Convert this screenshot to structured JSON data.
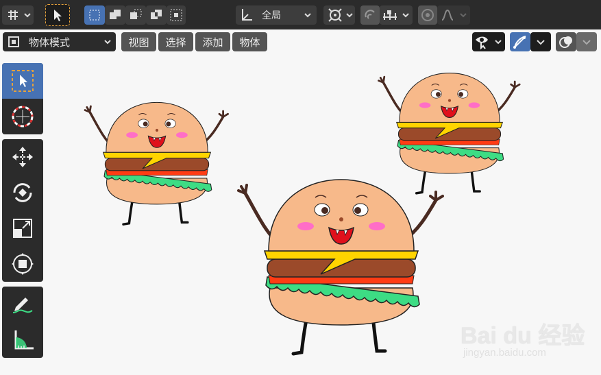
{
  "header": {
    "transform_orientation": "全局",
    "mode_selector": "物体模式"
  },
  "menus": [
    {
      "label": "视图"
    },
    {
      "label": "选择"
    },
    {
      "label": "添加"
    },
    {
      "label": "物体"
    }
  ],
  "toolbar_tools": [
    {
      "name": "select-box-icon"
    },
    {
      "name": "cursor-icon"
    },
    {
      "name": "move-icon"
    },
    {
      "name": "rotate-icon"
    },
    {
      "name": "scale-icon"
    },
    {
      "name": "transform-icon"
    },
    {
      "name": "annotate-icon"
    },
    {
      "name": "measure-icon"
    }
  ],
  "watermark": {
    "brand": "Bai du 经验",
    "url": "jingyan.baidu.com"
  },
  "colors": {
    "accent": "#4772b3",
    "bun": "#f7b98a",
    "cheese": "#ffd400",
    "patty": "#9b4a2a",
    "tomato": "#ff3c14",
    "lettuce": "#3ddc84"
  }
}
